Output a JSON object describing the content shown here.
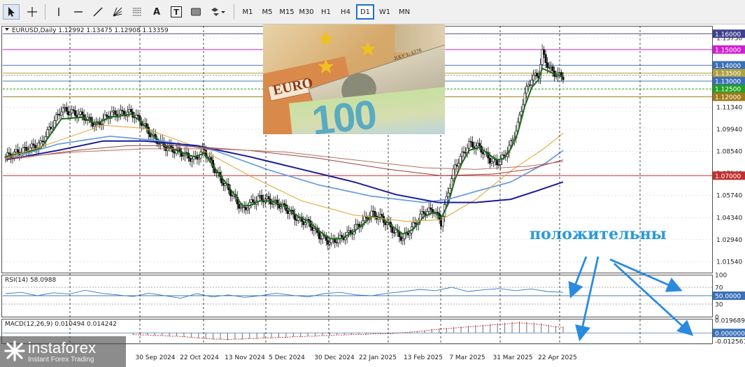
{
  "toolbar": {
    "tools": [
      {
        "icon": "cursor-arrow-icon"
      },
      {
        "icon": "crosshair-icon"
      },
      {
        "icon": "vertical-line-icon"
      },
      {
        "icon": "horizontal-line-icon"
      },
      {
        "icon": "trendline-icon"
      },
      {
        "icon": "fibonacci-fan-icon"
      },
      {
        "icon": "fibonacci-retracement-icon"
      },
      {
        "icon": "text-icon",
        "glyph": "A"
      },
      {
        "icon": "text-label-icon",
        "glyph": "T"
      },
      {
        "icon": "rectangle-icon"
      },
      {
        "icon": "shapes-dropdown-icon"
      }
    ],
    "timeframes": [
      "M1",
      "M5",
      "M15",
      "M30",
      "H1",
      "H4",
      "D1",
      "W1",
      "MN"
    ],
    "active_timeframe": "D1"
  },
  "chart_data": [
    {
      "type": "candlestick",
      "header": "EURUSD,Daily  1.12992 1.13475 1.12908 1.13359",
      "ylim": [
        1.0085,
        1.165
      ],
      "y_ticks": [
        "1.15730",
        "1.13350",
        "1.11340",
        "1.09940",
        "1.08540",
        "1.07140",
        "1.05740",
        "1.04340",
        "1.02940",
        "1.01540"
      ],
      "x_labels": [
        "30 Sep 2024",
        "22 Oct 2024",
        "13 Nov 2024",
        "5 Dec 2024",
        "30 Dec 2024",
        "22 Jan 2025",
        "13 Feb 2025",
        "7 Mar 2025",
        "31 Mar 2025",
        "22 Apr 2025"
      ],
      "close_path": [
        [
          0,
          1.082
        ],
        [
          10,
          1.09
        ],
        [
          16,
          1.112
        ],
        [
          22,
          1.108
        ],
        [
          26,
          1.102
        ],
        [
          30,
          1.109
        ],
        [
          36,
          1.11
        ],
        [
          39,
          1.104
        ],
        [
          42,
          1.095
        ],
        [
          46,
          1.088
        ],
        [
          50,
          1.085
        ],
        [
          54,
          1.08
        ],
        [
          57,
          1.086
        ],
        [
          61,
          1.07
        ],
        [
          65,
          1.058
        ],
        [
          68,
          1.048
        ],
        [
          70,
          1.052
        ],
        [
          73,
          1.056
        ],
        [
          76,
          1.054
        ],
        [
          80,
          1.05
        ],
        [
          84,
          1.042
        ],
        [
          87,
          1.04
        ],
        [
          90,
          1.032
        ],
        [
          93,
          1.028
        ],
        [
          96,
          1.03
        ],
        [
          99,
          1.034
        ],
        [
          102,
          1.04
        ],
        [
          105,
          1.046
        ],
        [
          108,
          1.043
        ],
        [
          111,
          1.036
        ],
        [
          114,
          1.03
        ],
        [
          117,
          1.038
        ],
        [
          120,
          1.047
        ],
        [
          123,
          1.048
        ],
        [
          125,
          1.04
        ],
        [
          127,
          1.06
        ],
        [
          129,
          1.076
        ],
        [
          131,
          1.083
        ],
        [
          133,
          1.09
        ],
        [
          136,
          1.088
        ],
        [
          139,
          1.08
        ],
        [
          141,
          1.078
        ],
        [
          143,
          1.082
        ],
        [
          145,
          1.09
        ],
        [
          147,
          1.102
        ],
        [
          149,
          1.122
        ],
        [
          151,
          1.132
        ],
        [
          153,
          1.134
        ],
        [
          154,
          1.148
        ],
        [
          156,
          1.138
        ],
        [
          158,
          1.134
        ],
        [
          160,
          1.133
        ]
      ],
      "ma_lines": [
        {
          "color": "#1f6a1f",
          "points": [
            [
              0,
              1.082
            ],
            [
              10,
              1.087
            ],
            [
              16,
              1.106
            ],
            [
              22,
              1.107
            ],
            [
              26,
              1.103
            ],
            [
              30,
              1.107
            ],
            [
              36,
              1.109
            ],
            [
              39,
              1.104
            ],
            [
              42,
              1.096
            ],
            [
              46,
              1.089
            ],
            [
              50,
              1.085
            ],
            [
              54,
              1.082
            ],
            [
              57,
              1.084
            ],
            [
              61,
              1.072
            ],
            [
              65,
              1.06
            ],
            [
              68,
              1.051
            ],
            [
              70,
              1.051
            ],
            [
              73,
              1.054
            ],
            [
              76,
              1.054
            ],
            [
              80,
              1.051
            ],
            [
              84,
              1.044
            ],
            [
              87,
              1.041
            ],
            [
              90,
              1.035
            ],
            [
              93,
              1.03
            ],
            [
              96,
              1.03
            ],
            [
              99,
              1.033
            ],
            [
              102,
              1.038
            ],
            [
              105,
              1.044
            ],
            [
              108,
              1.043
            ],
            [
              111,
              1.038
            ],
            [
              114,
              1.033
            ],
            [
              117,
              1.036
            ],
            [
              120,
              1.044
            ],
            [
              123,
              1.047
            ],
            [
              125,
              1.043
            ],
            [
              127,
              1.052
            ],
            [
              129,
              1.068
            ],
            [
              131,
              1.078
            ],
            [
              133,
              1.086
            ],
            [
              136,
              1.088
            ],
            [
              139,
              1.083
            ],
            [
              141,
              1.08
            ],
            [
              143,
              1.081
            ],
            [
              145,
              1.087
            ],
            [
              147,
              1.097
            ],
            [
              149,
              1.114
            ],
            [
              151,
              1.126
            ],
            [
              153,
              1.131
            ],
            [
              154,
              1.138
            ],
            [
              156,
              1.136
            ],
            [
              158,
              1.134
            ],
            [
              160,
              1.133
            ]
          ]
        },
        {
          "color": "#6aa0dc",
          "points": [
            [
              0,
              1.08
            ],
            [
              15,
              1.09
            ],
            [
              30,
              1.095
            ],
            [
              45,
              1.092
            ],
            [
              60,
              1.086
            ],
            [
              75,
              1.074
            ],
            [
              90,
              1.064
            ],
            [
              105,
              1.057
            ],
            [
              120,
              1.053
            ],
            [
              127,
              1.055
            ],
            [
              135,
              1.06
            ],
            [
              145,
              1.066
            ],
            [
              155,
              1.078
            ],
            [
              160,
              1.086
            ]
          ]
        },
        {
          "color": "#e0a030",
          "points": [
            [
              0,
              1.081
            ],
            [
              15,
              1.092
            ],
            [
              28,
              1.102
            ],
            [
              40,
              1.1
            ],
            [
              55,
              1.088
            ],
            [
              70,
              1.07
            ],
            [
              85,
              1.054
            ],
            [
              100,
              1.045
            ],
            [
              115,
              1.041
            ],
            [
              125,
              1.042
            ],
            [
              135,
              1.055
            ],
            [
              145,
              1.073
            ],
            [
              155,
              1.088
            ],
            [
              160,
              1.097
            ]
          ]
        },
        {
          "color": "#1a1a9a",
          "points": [
            [
              0,
              1.08
            ],
            [
              15,
              1.086
            ],
            [
              28,
              1.092
            ],
            [
              40,
              1.092
            ],
            [
              55,
              1.089
            ],
            [
              70,
              1.082
            ],
            [
              85,
              1.074
            ],
            [
              100,
              1.066
            ],
            [
              112,
              1.058
            ],
            [
              124,
              1.053
            ],
            [
              135,
              1.053
            ],
            [
              145,
              1.055
            ],
            [
              152,
              1.06
            ],
            [
              160,
              1.066
            ]
          ]
        },
        {
          "color": "#a04040",
          "points": [
            [
              0,
              1.08
            ],
            [
              20,
              1.086
            ],
            [
              35,
              1.089
            ],
            [
              50,
              1.089
            ],
            [
              70,
              1.086
            ],
            [
              90,
              1.081
            ],
            [
              110,
              1.074
            ],
            [
              125,
              1.07
            ],
            [
              140,
              1.071
            ],
            [
              150,
              1.074
            ],
            [
              160,
              1.08
            ]
          ]
        },
        {
          "color": "#b07060",
          "points": [
            [
              0,
              1.081
            ],
            [
              20,
              1.085
            ],
            [
              40,
              1.087
            ],
            [
              60,
              1.087
            ],
            [
              80,
              1.085
            ],
            [
              100,
              1.08
            ],
            [
              120,
              1.075
            ],
            [
              135,
              1.074
            ],
            [
              150,
              1.076
            ],
            [
              160,
              1.079
            ]
          ]
        }
      ],
      "levels": [
        {
          "label": "1.16000",
          "value": 1.16,
          "color": "#4a4a8a",
          "label_bg": "#404090"
        },
        {
          "label": "1.15000",
          "value": 1.15,
          "color": "#d020d0",
          "label_bg": "#d020d0"
        },
        {
          "label": "1.14000",
          "value": 1.14,
          "color": "#4a78b0",
          "label_bg": "#3a70b8"
        },
        {
          "label": "1.13500",
          "value": 1.135,
          "color": "#b0a030",
          "label_bg": "#b0a040"
        },
        {
          "label": "1.13000",
          "value": 1.13,
          "color": "#4a78b0",
          "label_bg": "#3a70b8"
        },
        {
          "label": "1.12500",
          "value": 1.125,
          "color": "#20a020",
          "label_bg": "#22a022"
        },
        {
          "label": "1.12000",
          "value": 1.12,
          "color": "#a08020",
          "label_bg": "#a07a18"
        },
        {
          "label": "1.07000",
          "value": 1.07,
          "color": "#c03030",
          "label_bg": "#c03030"
        }
      ],
      "annotation": "положительны"
    },
    {
      "type": "line",
      "header": "RSI(14) 58.0988",
      "ylim": [
        0,
        100
      ],
      "y_ticks": [
        "100",
        "70",
        "50.0000",
        "30",
        "0"
      ],
      "series": [
        {
          "values": [
            55,
            58,
            50,
            57,
            54,
            63,
            56,
            52,
            48,
            56,
            50,
            44,
            55,
            47,
            52,
            46,
            50,
            56,
            51,
            47,
            55,
            58,
            52,
            50,
            56,
            60,
            65,
            62,
            70,
            60,
            64,
            67,
            62,
            66,
            60,
            58
          ]
        }
      ]
    },
    {
      "type": "bar",
      "header": "MACD(12,26,9) 0.010494 0.014242",
      "ylim": [
        -0.016,
        0.022
      ],
      "y_ticks": [
        "0.019689",
        "0.000000",
        "-0.012561"
      ],
      "series": [
        {
          "values": [
            -0.002,
            -0.003,
            -0.003,
            -0.004,
            -0.004,
            -0.005,
            -0.005,
            -0.006,
            -0.007,
            -0.008,
            -0.009,
            -0.01,
            -0.01,
            -0.011,
            -0.01,
            -0.01,
            -0.009,
            -0.009,
            -0.008,
            -0.008,
            -0.007,
            -0.007,
            -0.006,
            -0.006,
            -0.005,
            -0.005,
            -0.004,
            -0.004,
            -0.003,
            -0.003,
            -0.002,
            -0.002,
            -0.002,
            -0.001,
            -0.001,
            -0.001,
            0.0,
            0.001,
            0.002,
            0.003,
            0.004,
            0.006,
            0.007,
            0.008,
            0.009,
            0.01,
            0.011,
            0.012,
            0.013,
            0.014,
            0.015,
            0.016,
            0.017,
            0.018,
            0.017,
            0.016,
            0.015,
            0.013,
            0.011,
            0.01
          ]
        }
      ]
    }
  ],
  "photo": {
    "note_text": "EURO",
    "big_number": "100",
    "stamp_text": "JULY 1, 1776"
  },
  "logo": {
    "name": "instaforex",
    "tagline": "Instant Forex Trading"
  }
}
